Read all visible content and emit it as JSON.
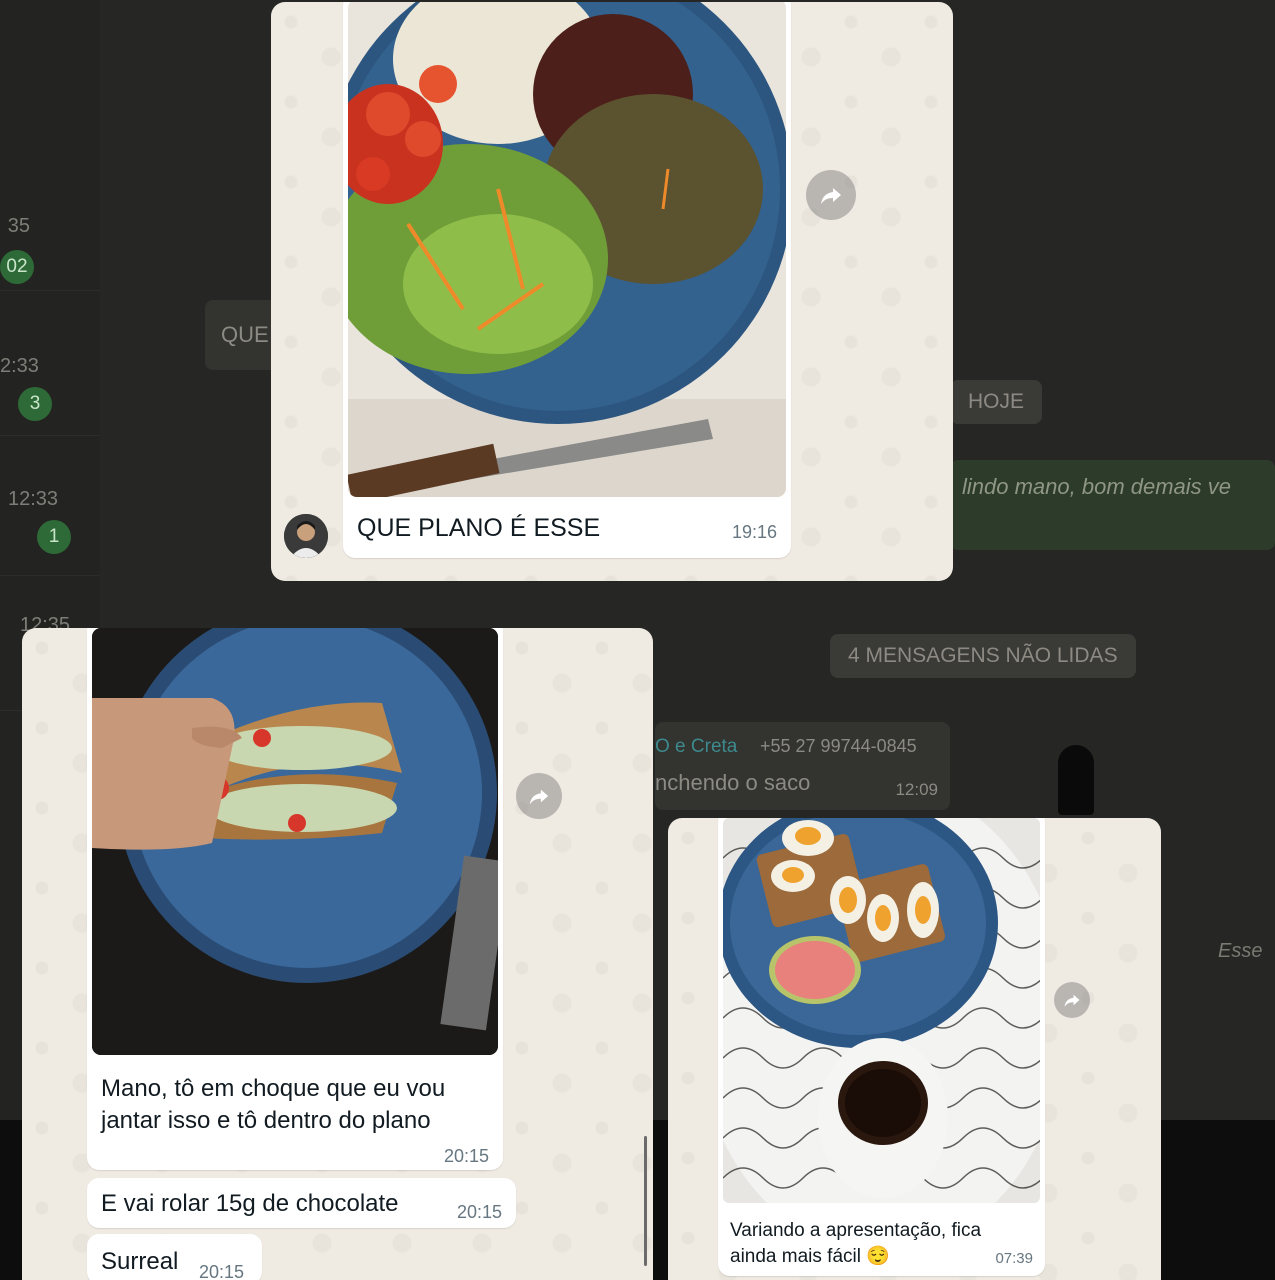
{
  "background_chat": {
    "list_times": [
      "35",
      "2:33",
      "12:33",
      "12:35"
    ],
    "list_badges": [
      "02",
      "3",
      "1"
    ],
    "preview_snippet": "QUE",
    "date_pill": "HOJE",
    "green_message": "lindo mano, bom demais ve",
    "unread_pill": "4 MENSAGENS NÃO LIDAS",
    "group_sender": "O e Creta",
    "group_phone": "+55 27 99744-0845",
    "group_message": "nchendo o saco",
    "group_time": "12:09",
    "right_snippet": "Esse"
  },
  "card_top": {
    "caption": "QUE PLANO É ESSE",
    "time": "19:16"
  },
  "card_left": {
    "caption": "Mano, tô em choque que eu vou jantar isso e tô dentro do plano",
    "caption_time": "20:15",
    "messages": [
      {
        "text": "E vai rolar 15g de chocolate",
        "time": "20:15"
      },
      {
        "text": "Surreal",
        "time": "20:15"
      }
    ]
  },
  "card_right": {
    "caption": "Variando a apresentação, fica ainda mais fácil 😌",
    "time": "07:39"
  },
  "colors": {
    "wallpaper": "#efeae2",
    "bubble": "#ffffff",
    "plate_blue": "#2f5b86",
    "timestamp": "#667781"
  },
  "icons": [
    "forward-icon",
    "profile-avatar"
  ]
}
